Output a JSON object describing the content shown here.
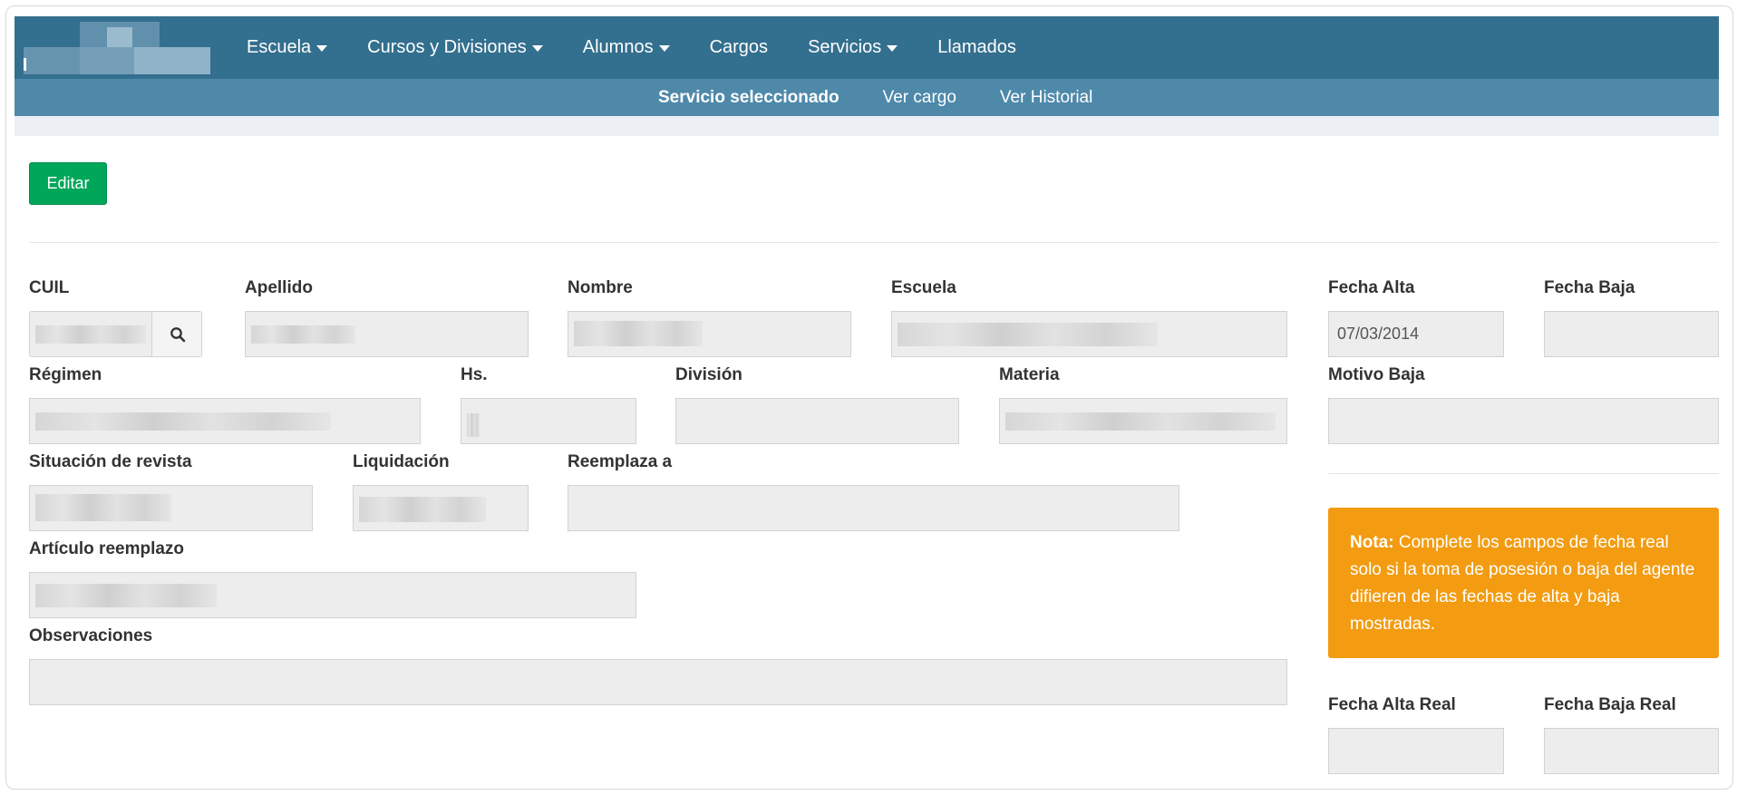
{
  "nav": {
    "items": [
      {
        "label": "Escuela",
        "dropdown": true
      },
      {
        "label": "Cursos y Divisiones",
        "dropdown": true
      },
      {
        "label": "Alumnos",
        "dropdown": true
      },
      {
        "label": "Cargos",
        "dropdown": false
      },
      {
        "label": "Servicios",
        "dropdown": true
      },
      {
        "label": "Llamados",
        "dropdown": false
      }
    ]
  },
  "subnav": {
    "items": [
      {
        "label": "Servicio seleccionado",
        "active": true
      },
      {
        "label": "Ver cargo",
        "active": false
      },
      {
        "label": "Ver Historial",
        "active": false
      }
    ]
  },
  "actions": {
    "edit_label": "Editar"
  },
  "form": {
    "cuil": {
      "label": "CUIL"
    },
    "apellido": {
      "label": "Apellido"
    },
    "nombre": {
      "label": "Nombre"
    },
    "escuela": {
      "label": "Escuela"
    },
    "fecha_alta": {
      "label": "Fecha Alta",
      "value": "07/03/2014"
    },
    "fecha_baja": {
      "label": "Fecha Baja",
      "value": ""
    },
    "regimen": {
      "label": "Régimen"
    },
    "hs": {
      "label": "Hs."
    },
    "division": {
      "label": "División",
      "value": ""
    },
    "materia": {
      "label": "Materia"
    },
    "motivo_baja": {
      "label": "Motivo Baja",
      "value": ""
    },
    "situacion_revista": {
      "label": "Situación de revista"
    },
    "liquidacion": {
      "label": "Liquidación"
    },
    "reemplaza_a": {
      "label": "Reemplaza a",
      "value": ""
    },
    "articulo_reemplazo": {
      "label": "Artículo reemplazo"
    },
    "observaciones": {
      "label": "Observaciones",
      "value": ""
    },
    "fecha_alta_real": {
      "label": "Fecha Alta Real",
      "value": ""
    },
    "fecha_baja_real": {
      "label": "Fecha Baja Real",
      "value": ""
    }
  },
  "note": {
    "prefix": "Nota:",
    "text": " Complete los campos de fecha real solo si la toma de posesión o baja del agente difieren de las fechas de alta y baja mostradas."
  },
  "colors": {
    "nav_bg": "#336f8e",
    "subnav_bg": "#4e89aa",
    "edit_button": "#00a65a",
    "note_bg": "#f39c12",
    "field_bg": "#ededed"
  },
  "icons": {
    "cuil_search": "search-icon",
    "dropdown": "caret-down-icon"
  }
}
